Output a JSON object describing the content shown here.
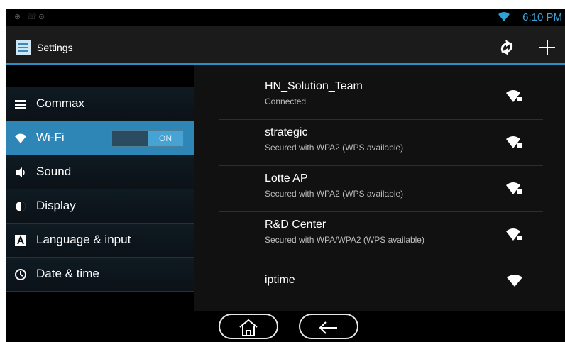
{
  "status_bar": {
    "time": "6:10 PM"
  },
  "action_bar": {
    "title": "Settings"
  },
  "sidebar": {
    "items": [
      {
        "label": "Commax",
        "icon": "list-icon"
      },
      {
        "label": "Wi-Fi",
        "icon": "wifi-icon",
        "toggle": "ON",
        "selected": true
      },
      {
        "label": "Sound",
        "icon": "speaker-icon"
      },
      {
        "label": "Display",
        "icon": "brightness-icon"
      },
      {
        "label": "Language & input",
        "icon": "keyboard-icon"
      },
      {
        "label": "Date & time",
        "icon": "clock-icon"
      }
    ]
  },
  "networks": [
    {
      "name": "HN_Solution_Team",
      "status": "Connected",
      "secured": true
    },
    {
      "name": "strategic",
      "status": "Secured with WPA2 (WPS available)",
      "secured": true
    },
    {
      "name": "Lotte AP",
      "status": "Secured with WPA2 (WPS available)",
      "secured": true
    },
    {
      "name": "R&D Center",
      "status": "Secured with WPA/WPA2 (WPS available)",
      "secured": true
    },
    {
      "name": "iptime",
      "status": "",
      "secured": false
    }
  ],
  "colors": {
    "accent": "#2d86b6",
    "time": "#3aa6dc",
    "background": "#000000"
  }
}
